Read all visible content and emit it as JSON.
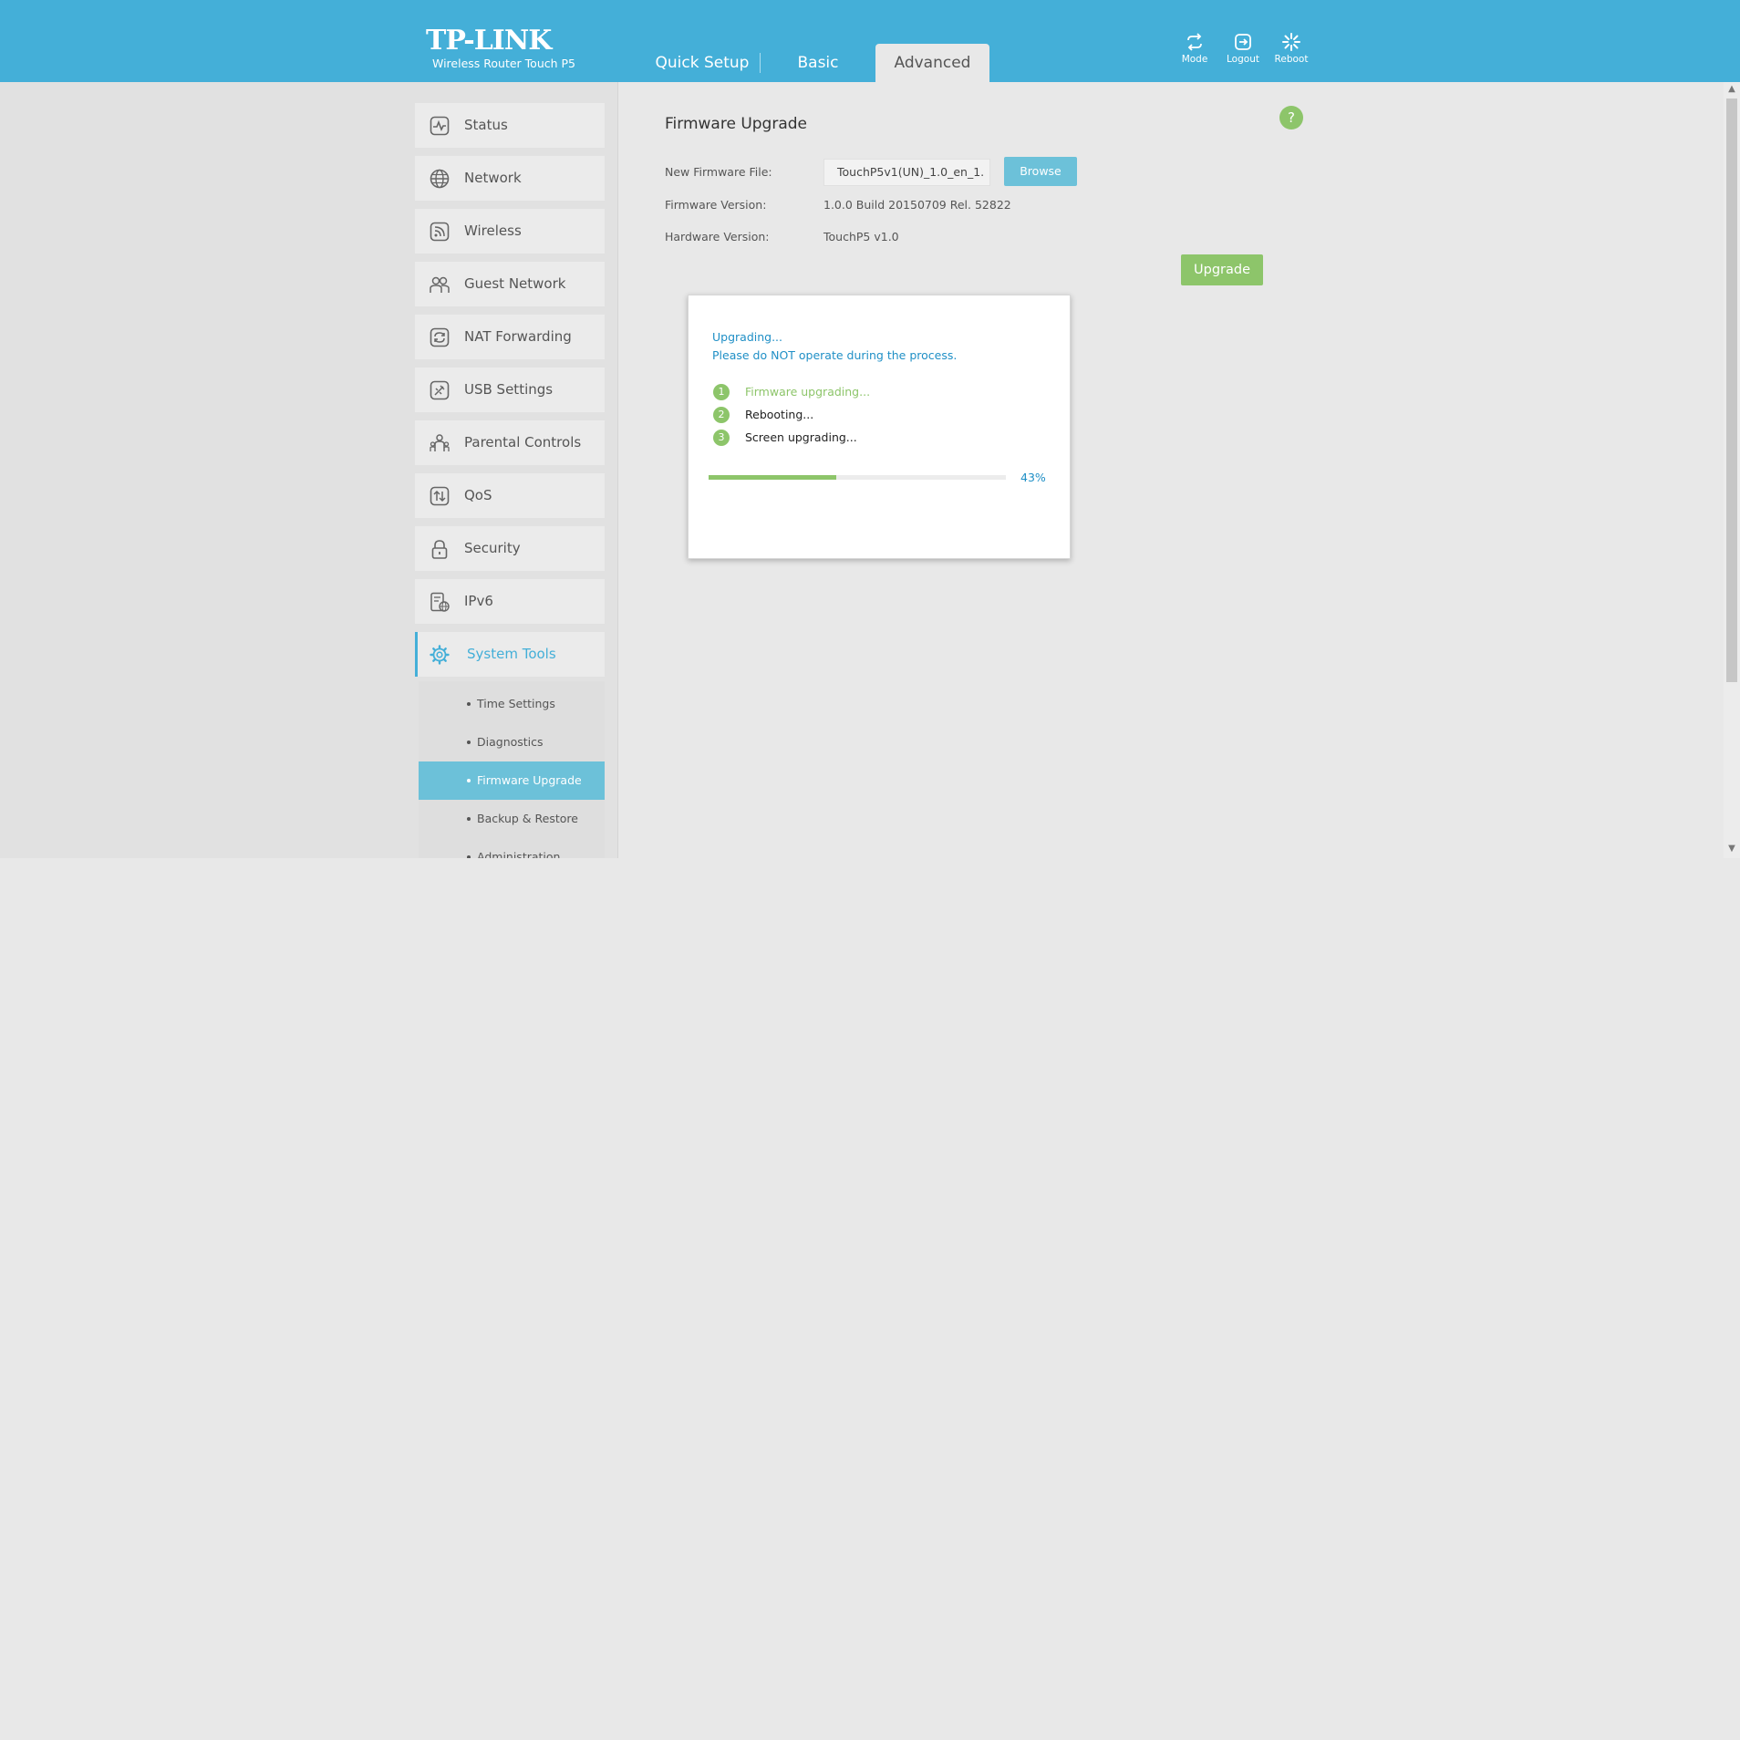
{
  "header": {
    "logo": "TP-LINK",
    "subtitle": "Wireless Router Touch P5",
    "tabs": {
      "quick_setup": "Quick Setup",
      "basic": "Basic",
      "advanced": "Advanced"
    },
    "buttons": {
      "mode": "Mode",
      "logout": "Logout",
      "reboot": "Reboot"
    }
  },
  "sidebar": {
    "items": [
      {
        "label": "Status",
        "icon": "status-icon"
      },
      {
        "label": "Network",
        "icon": "globe-icon"
      },
      {
        "label": "Wireless",
        "icon": "wifi-icon"
      },
      {
        "label": "Guest Network",
        "icon": "guest-users-icon"
      },
      {
        "label": "NAT Forwarding",
        "icon": "refresh-icon"
      },
      {
        "label": "USB Settings",
        "icon": "usb-icon"
      },
      {
        "label": "Parental Controls",
        "icon": "family-icon"
      },
      {
        "label": "QoS",
        "icon": "qos-icon"
      },
      {
        "label": "Security",
        "icon": "lock-icon"
      },
      {
        "label": "IPv6",
        "icon": "ipv6-icon"
      },
      {
        "label": "System Tools",
        "icon": "gear-icon"
      }
    ],
    "submenu": [
      {
        "label": "Time Settings"
      },
      {
        "label": "Diagnostics"
      },
      {
        "label": "Firmware Upgrade"
      },
      {
        "label": "Backup & Restore"
      },
      {
        "label": "Administration"
      }
    ]
  },
  "content": {
    "title": "Firmware Upgrade",
    "help": "?",
    "fields": {
      "new_firmware_label": "New Firmware File:",
      "new_firmware_value": "TouchP5v1(UN)_1.0_en_1.",
      "firmware_version_label": "Firmware Version:",
      "firmware_version_value": "1.0.0 Build 20150709 Rel. 52822",
      "hardware_version_label": "Hardware Version:",
      "hardware_version_value": "TouchP5 v1.0"
    },
    "browse_label": "Browse",
    "upgrade_label": "Upgrade"
  },
  "dialog": {
    "line1": "Upgrading...",
    "line2": "Please do NOT operate during the process.",
    "steps": [
      {
        "num": "1",
        "label": "Firmware upgrading..."
      },
      {
        "num": "2",
        "label": "Rebooting..."
      },
      {
        "num": "3",
        "label": "Screen upgrading..."
      }
    ],
    "progress": 43,
    "progress_text": "43%"
  },
  "colors": {
    "brand_blue": "#44afd8",
    "green": "#8dc56a",
    "link_blue": "#1f8fc6"
  }
}
